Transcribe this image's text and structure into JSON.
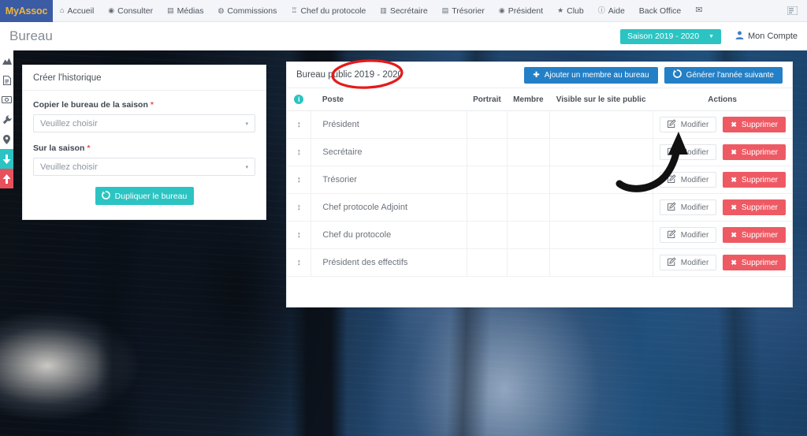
{
  "navbar": {
    "brand": "MyAssoc",
    "items": [
      {
        "label": "Accueil",
        "icon": "home-icon",
        "glyph": "⌂"
      },
      {
        "label": "Consulter",
        "icon": "eye-icon",
        "glyph": "◉"
      },
      {
        "label": "Médias",
        "icon": "file-icon",
        "glyph": "▤"
      },
      {
        "label": "Commissions",
        "icon": "globe-icon",
        "glyph": "◍"
      },
      {
        "label": "Chef du protocole",
        "icon": "trophy-icon",
        "glyph": "♖"
      },
      {
        "label": "Secrétaire",
        "icon": "book-icon",
        "glyph": "▥"
      },
      {
        "label": "Trésorier",
        "icon": "money-icon",
        "glyph": "▤"
      },
      {
        "label": "Président",
        "icon": "badge-icon",
        "glyph": "◉"
      },
      {
        "label": "Club",
        "icon": "star-icon",
        "glyph": "★"
      },
      {
        "label": "Aide",
        "icon": "info-icon",
        "glyph": "ⓘ"
      },
      {
        "label": "Back Office",
        "icon": "none",
        "glyph": ""
      },
      {
        "label": "",
        "icon": "envelope-icon",
        "glyph": "✉"
      }
    ],
    "right_icon": "list-menu-icon",
    "right_icon_glyph": "☰"
  },
  "titlebar": {
    "page_title": "Bureau",
    "season_label": "Saison 2019 - 2020",
    "season_caret": "▼",
    "account_label": "Mon Compte",
    "account_icon": "user-icon",
    "account_icon_glyph": "♟"
  },
  "rail": {
    "items": [
      {
        "name": "chart-icon"
      },
      {
        "name": "document-icon"
      },
      {
        "name": "money-icon"
      },
      {
        "name": "wrench-icon"
      },
      {
        "name": "location-pin-icon"
      },
      {
        "name": "download-arrow-icon"
      },
      {
        "name": "upload-arrow-icon"
      }
    ]
  },
  "left_card": {
    "header": "Créer l'historique",
    "field1_label": "Copier le bureau de la saison",
    "field1_required": "*",
    "field1_value": "Veuillez choisir",
    "field2_label": "Sur la saison",
    "field2_required": "*",
    "field2_value": "Veuillez choisir",
    "submit_label": "Dupliquer le bureau",
    "submit_icon": "refresh-icon",
    "submit_icon_glyph": "↻",
    "caret": "▾"
  },
  "right_card": {
    "title": "Bureau public  2019 - 2020",
    "add_button_label": "Ajouter un membre au bureau",
    "add_button_icon": "plus-icon",
    "add_button_glyph": "✚",
    "generate_button_label": "Générer l'année suivante",
    "generate_button_icon": "refresh-icon",
    "generate_button_glyph": "↻",
    "table": {
      "columns": [
        "",
        "Poste",
        "Portrait",
        "Membre",
        "Visible sur le site public",
        "Actions"
      ],
      "info_badge": "i",
      "sort_handle_glyph": "↕",
      "edit_label": "Modifier",
      "edit_icon": "pencil-square-icon",
      "delete_label": "Supprimer",
      "delete_icon": "x-icon",
      "delete_glyph": "✖",
      "rows": [
        {
          "poste": "Président",
          "portrait": "",
          "membre": "",
          "visible": ""
        },
        {
          "poste": "Secrétaire",
          "portrait": "",
          "membre": "",
          "visible": ""
        },
        {
          "poste": "Trésorier",
          "portrait": "",
          "membre": "",
          "visible": ""
        },
        {
          "poste": "Chef protocole Adjoint",
          "portrait": "",
          "membre": "",
          "visible": ""
        },
        {
          "poste": "Chef du protocole",
          "portrait": "",
          "membre": "",
          "visible": ""
        },
        {
          "poste": "Président des effectifs",
          "portrait": "",
          "membre": "",
          "visible": ""
        }
      ]
    }
  },
  "annotations": {
    "ellipse_color": "#e31b1b",
    "arrow_color": "#111111"
  },
  "colors": {
    "brand_blue": "#3b5ba5",
    "brand_yellow": "#f2b632",
    "teal": "#2bc4c2",
    "blue_button": "#2480c6",
    "red_button": "#ee5a64"
  }
}
